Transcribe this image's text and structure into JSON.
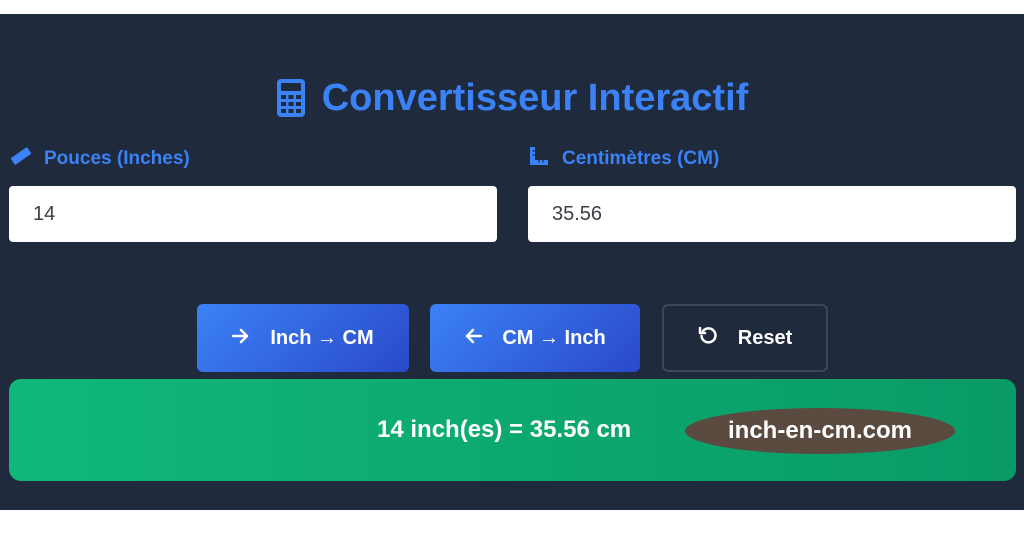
{
  "header": {
    "title": "Convertisseur Interactif",
    "title_icon": "calculator-icon"
  },
  "inputs": {
    "inches": {
      "label": "Pouces (Inches)",
      "icon": "ruler-icon",
      "value": "14"
    },
    "cm": {
      "label": "Centimètres (CM)",
      "icon": "ruler-combined-icon",
      "value": "35.56"
    }
  },
  "buttons": {
    "inch_to_cm": {
      "label": "Inch → CM",
      "icon": "arrow-right-icon"
    },
    "cm_to_inch": {
      "label": "CM → Inch",
      "icon": "arrow-left-icon"
    },
    "reset": {
      "label": "Reset",
      "icon": "undo-icon"
    }
  },
  "result": {
    "text": "14 inch(es) = 35.56 cm",
    "site": "inch-en-cm.com"
  },
  "colors": {
    "panel_bg": "#1f2a3c",
    "accent": "#3b82f6",
    "result_bg": "#10b77a",
    "badge_bg": "#5a4a3f"
  }
}
